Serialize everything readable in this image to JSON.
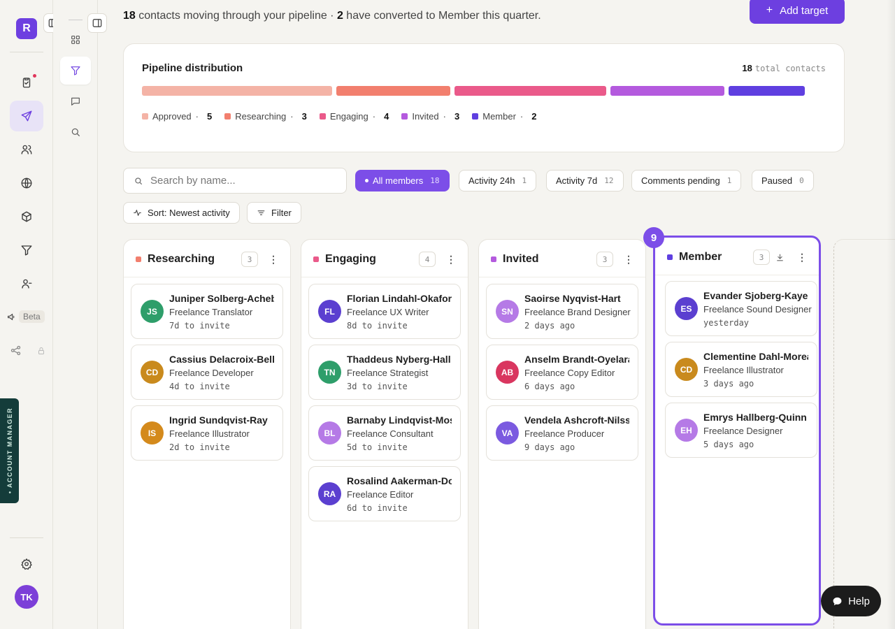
{
  "rail": {
    "logo": "R",
    "beta_label": "Beta",
    "avatar": "TK",
    "account_manager": "• ACCOUNT MANAGER"
  },
  "header": {
    "count_contacts": "18",
    "subtitle_part1": " contacts moving through your pipeline · ",
    "count_converted": "2",
    "subtitle_part2": " have converted to Member this quarter.",
    "add_button": "Add target"
  },
  "distribution": {
    "title": "Pipeline distribution",
    "total": "18",
    "total_unit": "total contacts",
    "segments": [
      {
        "label": "Approved",
        "count": 5,
        "color": "#f4b3a6"
      },
      {
        "label": "Researching",
        "count": 3,
        "color": "#f27f6e"
      },
      {
        "label": "Engaging",
        "count": 4,
        "color": "#ea5a8a"
      },
      {
        "label": "Invited",
        "count": 3,
        "color": "#b45ade"
      },
      {
        "label": "Member",
        "count": 2,
        "color": "#5f3fe0"
      }
    ]
  },
  "search": {
    "placeholder": "Search by name..."
  },
  "filters": [
    {
      "label": "All members",
      "count": "18"
    },
    {
      "label": "Activity 24h",
      "count": "1"
    },
    {
      "label": "Activity 7d",
      "count": "12"
    },
    {
      "label": "Comments pending",
      "count": "1"
    },
    {
      "label": "Paused",
      "count": "0"
    }
  ],
  "tools": {
    "sort": "Sort: Newest activity",
    "filter": "Filter"
  },
  "badge": "9",
  "columns": [
    {
      "name": "Researching",
      "count": "3",
      "color": "#f27f6e",
      "cards": [
        {
          "initials": "JS",
          "name": "Juniper Solberg-Achebe",
          "role": "Freelance Translator",
          "time": "7d to invite",
          "color": "#2e9e6a"
        },
        {
          "initials": "CD",
          "name": "Cassius Delacroix-Bell",
          "role": "Freelance Developer",
          "time": "4d to invite",
          "color": "#c98a1d"
        },
        {
          "initials": "IS",
          "name": "Ingrid Sundqvist-Ray",
          "role": "Freelance Illustrator",
          "time": "2d to invite",
          "color": "#d48a1c"
        }
      ]
    },
    {
      "name": "Engaging",
      "count": "4",
      "color": "#ea5a8a",
      "cards": [
        {
          "initials": "FL",
          "name": "Florian Lindahl-Okafor",
          "role": "Freelance UX Writer",
          "time": "8d to invite",
          "color": "#5b3fd0"
        },
        {
          "initials": "TN",
          "name": "Thaddeus Nyberg-Hall",
          "role": "Freelance Strategist",
          "time": "3d to invite",
          "color": "#2e9e6a"
        },
        {
          "initials": "BL",
          "name": "Barnaby Lindqvist-Moss",
          "role": "Freelance Consultant",
          "time": "5d to invite",
          "color": "#b57ae6"
        },
        {
          "initials": "RA",
          "name": "Rosalind Aakerman-Doyle",
          "role": "Freelance Editor",
          "time": "6d to invite",
          "color": "#5b3fd0"
        }
      ]
    },
    {
      "name": "Invited",
      "count": "3",
      "color": "#b45ade",
      "cards": [
        {
          "initials": "SN",
          "name": "Saoirse Nyqvist-Hart",
          "role": "Freelance Brand Designer",
          "time": "2 days ago",
          "color": "#b57ae6"
        },
        {
          "initials": "AB",
          "name": "Anselm Brandt-Oyelaran",
          "role": "Freelance Copy Editor",
          "time": "6 days ago",
          "color": "#d9365f"
        },
        {
          "initials": "VA",
          "name": "Vendela Ashcroft-Nilsson",
          "role": "Freelance Producer",
          "time": "9 days ago",
          "color": "#7b5ae0"
        }
      ]
    },
    {
      "name": "Member",
      "count": "3",
      "color": "#5f3fe0",
      "cards": [
        {
          "initials": "ES",
          "name": "Evander Sjoberg-Kaye",
          "role": "Freelance Sound Designer",
          "time": "yesterday",
          "color": "#5b3fd0"
        },
        {
          "initials": "CD",
          "name": "Clementine Dahl-Moreau",
          "role": "Freelance Illustrator",
          "time": "3 days ago",
          "color": "#c98a1d"
        },
        {
          "initials": "EH",
          "name": "Emrys Hallberg-Quinn",
          "role": "Freelance Designer",
          "time": "5 days ago",
          "color": "#b57ae6"
        }
      ]
    }
  ],
  "help": "Help"
}
